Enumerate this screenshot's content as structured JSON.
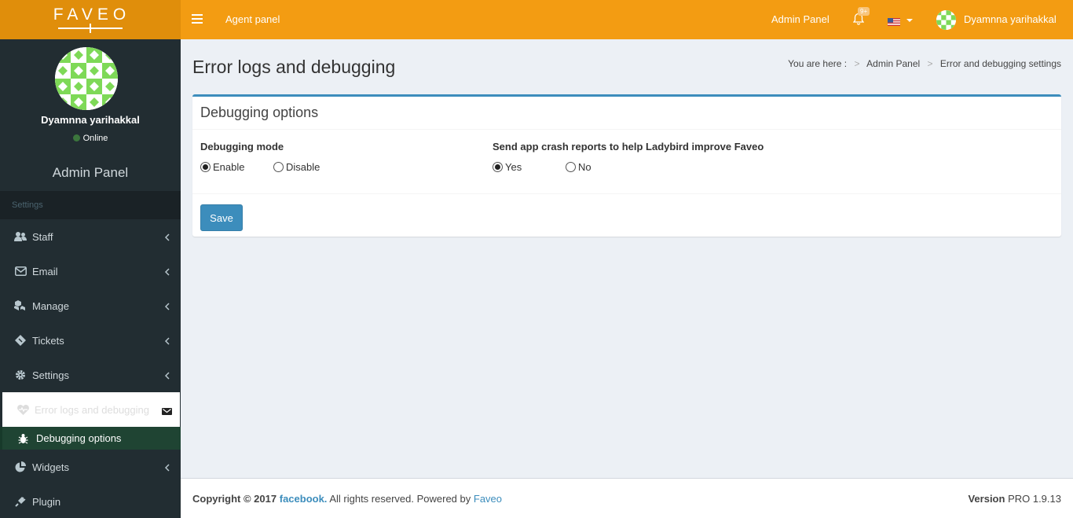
{
  "brand": {
    "logo_text": "FAVEO"
  },
  "user": {
    "name": "Dyamnna yarihakkal",
    "status": "Online"
  },
  "sidebar": {
    "panel_title": "Admin Panel",
    "section_header": "Settings",
    "items": [
      {
        "label": "Staff",
        "icon": "users-icon"
      },
      {
        "label": "Email",
        "icon": "envelope-icon"
      },
      {
        "label": "Manage",
        "icon": "cubes-icon"
      },
      {
        "label": "Tickets",
        "icon": "ticket-icon"
      },
      {
        "label": "Settings",
        "icon": "gear-icon"
      },
      {
        "label": "Error logs and debugging",
        "icon": "heartbeat-icon"
      },
      {
        "label": "Widgets",
        "icon": "pie-chart-icon"
      },
      {
        "label": "Plugin",
        "icon": "plug-icon"
      }
    ],
    "submenu": {
      "label": "Debugging options",
      "icon": "bug-icon"
    }
  },
  "header": {
    "agent_panel": "Agent panel",
    "admin_panel": "Admin Panel",
    "notification_badge": "9+",
    "user_name": "Dyamnna yarihakkal"
  },
  "page": {
    "title": "Error logs and debugging",
    "breadcrumb": {
      "prefix": "You are here :",
      "items": [
        "Admin Panel",
        "Error and debugging settings"
      ]
    }
  },
  "box": {
    "title": "Debugging options",
    "debug_mode": {
      "label": "Debugging mode",
      "options": [
        "Enable",
        "Disable"
      ],
      "selected": "Enable"
    },
    "crash_reports": {
      "label": "Send app crash reports to help Ladybird improve Faveo",
      "options": [
        "Yes",
        "No"
      ],
      "selected": "Yes"
    },
    "save_label": "Save"
  },
  "footer": {
    "copyright": "Copyright © 2017",
    "company": "facebook.",
    "rights": "All rights reserved. Powered by",
    "powered_by": "Faveo",
    "version_label": "Version",
    "version": "PRO 1.9.13"
  },
  "colors": {
    "header": "#f39c12",
    "logo_bg": "#e08e0b",
    "sidebar": "#222d32",
    "primary": "#3c8dbc"
  }
}
